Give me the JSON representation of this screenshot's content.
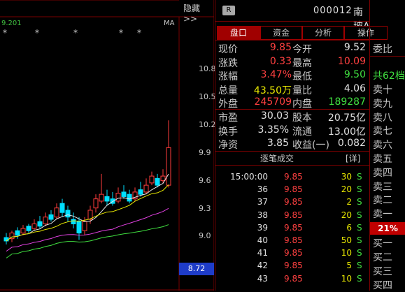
{
  "chart": {
    "hide_label": "隐藏>>",
    "top_value": "9.201",
    "ma_label": "MA",
    "star": "*",
    "yticks": [
      "10.8",
      "10.5",
      "10.2",
      "9.9",
      "9.6",
      "9.3",
      "9.0"
    ],
    "current_price_tag": "8.72"
  },
  "header": {
    "badge": "R",
    "code": "000012",
    "name": "南 玻A"
  },
  "tabs": [
    "盘口",
    "资金",
    "分析",
    "操作"
  ],
  "quote": {
    "rows": [
      {
        "l1": "现价",
        "v1": "9.85",
        "c1": "red",
        "l2": "今开",
        "v2": "9.52",
        "c2": "white"
      },
      {
        "l1": "涨跌",
        "v1": "0.33",
        "c1": "red",
        "l2": "最高",
        "v2": "10.09",
        "c2": "red"
      },
      {
        "l1": "涨幅",
        "v1": "3.47%",
        "c1": "red",
        "l2": "最低",
        "v2": "9.50",
        "c2": "green"
      },
      {
        "l1": "总量",
        "v1": "43.50万",
        "c1": "yellow",
        "l2": "量比",
        "v2": "4.06",
        "c2": "white"
      },
      {
        "l1": "外盘",
        "v1": "245709",
        "c1": "red",
        "l2": "内盘",
        "v2": "189287",
        "c2": "green"
      }
    ],
    "rows2": [
      {
        "l1": "市盈",
        "v1": "30.03",
        "l2": "股本",
        "v2": "20.75亿"
      },
      {
        "l1": "换手",
        "v1": "3.35%",
        "l2": "流通",
        "v2": "13.00亿"
      },
      {
        "l1": "净资",
        "v1": "3.85",
        "l2": "收益(一)",
        "v2": "0.082"
      }
    ]
  },
  "trades": {
    "title": "逐笔成交",
    "bracket": "[详]",
    "rows": [
      {
        "t": "15:00:00",
        "p": "9.85",
        "v": "30",
        "s": "S"
      },
      {
        "t": "36",
        "p": "9.85",
        "v": "20",
        "s": "S"
      },
      {
        "t": "37",
        "p": "9.85",
        "v": "2",
        "s": "S"
      },
      {
        "t": "38",
        "p": "9.85",
        "v": "20",
        "s": "S"
      },
      {
        "t": "39",
        "p": "9.85",
        "v": "6",
        "s": "S"
      },
      {
        "t": "40",
        "p": "9.85",
        "v": "50",
        "s": "S"
      },
      {
        "t": "41",
        "p": "9.85",
        "v": "10",
        "s": "S"
      },
      {
        "t": "42",
        "p": "9.85",
        "v": "5",
        "s": "S"
      },
      {
        "t": "43",
        "p": "9.85",
        "v": "10",
        "s": "S"
      }
    ]
  },
  "book": {
    "header": "委比",
    "count_label": "共62档",
    "sells": [
      "卖十",
      "卖九",
      "卖八",
      "卖七",
      "卖六",
      "卖五",
      "卖四",
      "卖三",
      "卖二",
      "卖一"
    ],
    "pct": "21%",
    "buys": [
      "买一",
      "买二",
      "买三",
      "买四"
    ]
  },
  "colors": {
    "up": "#ff4040",
    "down": "#40e040",
    "panel_border": "#7a0000",
    "tab_active": "#a00000"
  }
}
